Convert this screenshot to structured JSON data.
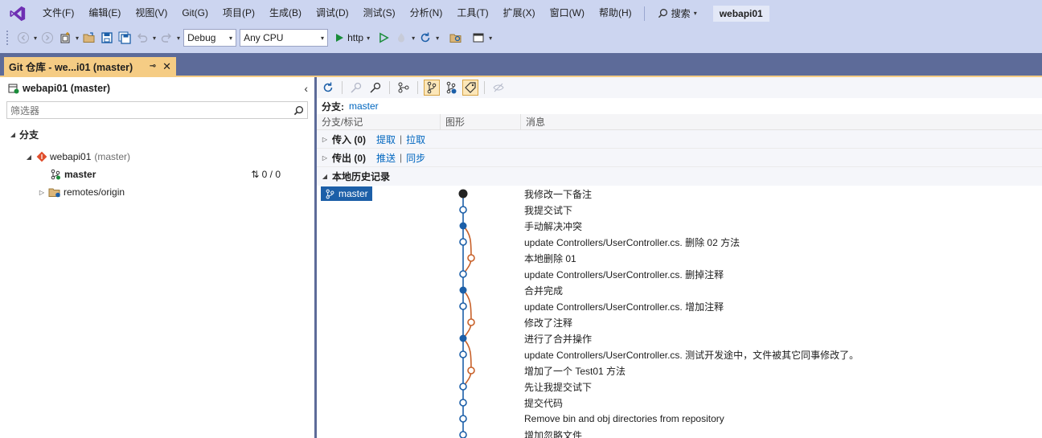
{
  "menu": {
    "items": [
      "文件(F)",
      "编辑(E)",
      "视图(V)",
      "Git(G)",
      "项目(P)",
      "生成(B)",
      "调试(D)",
      "测试(S)",
      "分析(N)",
      "工具(T)",
      "扩展(X)",
      "窗口(W)",
      "帮助(H)"
    ],
    "search_label": "搜索",
    "solution_name": "webapi01"
  },
  "toolbar": {
    "config": "Debug",
    "platform": "Any CPU",
    "run_target": "http"
  },
  "tab": {
    "title": "Git 仓库 - we...i01 (master)"
  },
  "left": {
    "header": "webapi01 (master)",
    "filter_placeholder": "筛选器",
    "branches_section": "分支",
    "repo_name": "webapi01",
    "repo_branch": "(master)",
    "current_branch": "master",
    "sync_info": "0 / 0",
    "remotes": "remotes/origin"
  },
  "right": {
    "branch_label": "分支:",
    "branch_value": "master",
    "columns": [
      "分支/标记",
      "图形",
      "消息"
    ],
    "incoming_label": "传入 (0)",
    "incoming_actions": [
      "提取",
      "拉取"
    ],
    "outgoing_label": "传出 (0)",
    "outgoing_actions": [
      "推送",
      "同步"
    ],
    "history_label": "本地历史记录",
    "head_tag": "master",
    "commits": [
      "我修改一下备注",
      "我提交试下",
      "手动解决冲突",
      "update Controllers/UserController.cs. 删除  02 方法",
      "本地删除 01",
      "update Controllers/UserController.cs. 删掉注释",
      "合并完成",
      "update Controllers/UserController.cs. 增加注释",
      "修改了注释",
      "进行了合并操作",
      "update Controllers/UserController.cs. 测试开发途中，文件被其它同事修改了。",
      "增加了一个 Test01 方法",
      "先让我提交试下",
      "提交代码",
      "Remove bin and obj directories from repository",
      "增加忽略文件"
    ]
  },
  "colors": {
    "accent": "#f5cc84",
    "graph_main": "#1c5fa8",
    "graph_side": "#c8612a",
    "link": "#0066bf"
  }
}
